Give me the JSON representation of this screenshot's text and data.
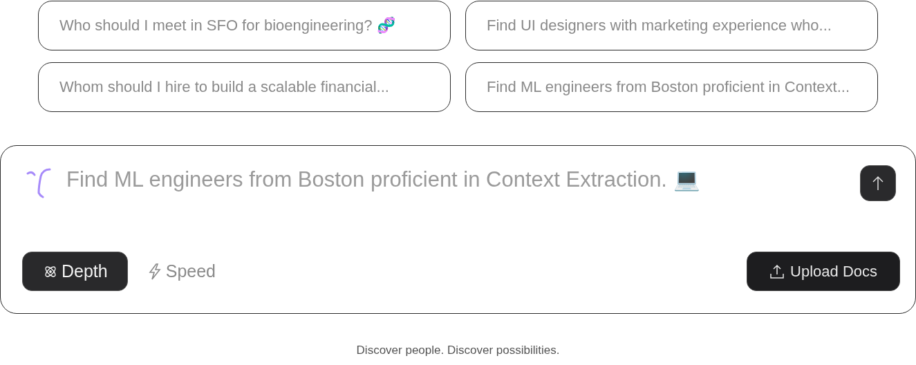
{
  "suggestions": [
    {
      "text": "Who should I meet in SFO for bioengineering? 🧬"
    },
    {
      "text": "Find UI designers with marketing experience who..."
    },
    {
      "text": "Whom should I hire to build a scalable financial..."
    },
    {
      "text": "Find ML engineers from Boston proficient in Context..."
    }
  ],
  "composer": {
    "placeholder": "Find ML engineers from Boston proficient in Context Extraction. 💻",
    "modes": [
      {
        "label": "Depth",
        "kind": "depth",
        "selected": true
      },
      {
        "label": "Speed",
        "kind": "speed",
        "selected": false
      }
    ],
    "upload_button": "Upload Docs"
  },
  "tagline": "Discover people. Discover possibilities."
}
